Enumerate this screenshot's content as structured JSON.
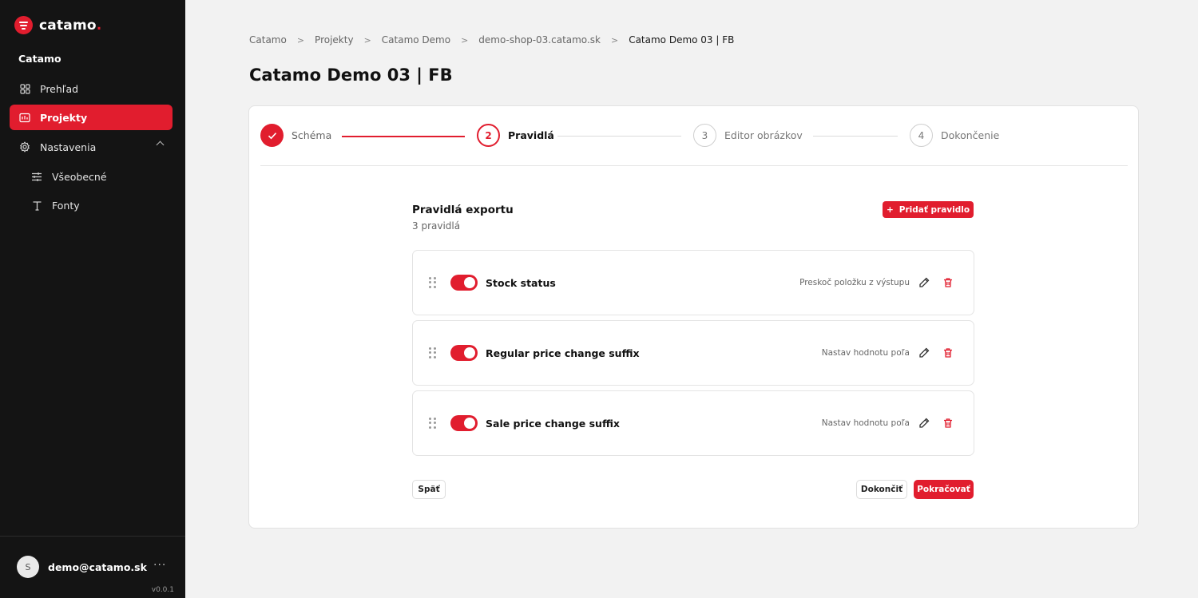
{
  "brand": {
    "name": "catamo",
    "dot": ".",
    "accent": "#e11d2e"
  },
  "sidebar": {
    "org": "Catamo",
    "items": [
      {
        "label": "Prehľad",
        "icon": "dashboard-icon"
      },
      {
        "label": "Projekty",
        "icon": "projects-icon",
        "active": true
      },
      {
        "label": "Nastavenia",
        "icon": "gear-icon",
        "expanded": true
      },
      {
        "label": "Všeobecné",
        "icon": "sliders-icon",
        "sub": true
      },
      {
        "label": "Fonty",
        "icon": "type-icon",
        "sub": true
      }
    ],
    "user": {
      "initial": "S",
      "email": "demo@catamo.sk",
      "more": "···"
    },
    "version": "v0.0.1"
  },
  "breadcrumb": [
    "Catamo",
    "Projekty",
    "Catamo Demo",
    "demo-shop-03.catamo.sk",
    "Catamo Demo 03 | FB"
  ],
  "page": {
    "title": "Catamo Demo 03 | FB"
  },
  "stepper": {
    "steps": [
      {
        "number": "",
        "label": "Schéma",
        "state": "done"
      },
      {
        "number": "2",
        "label": "Pravidlá",
        "state": "current"
      },
      {
        "number": "3",
        "label": "Editor obrázkov",
        "state": "todo"
      },
      {
        "number": "4",
        "label": "Dokončenie",
        "state": "todo"
      }
    ]
  },
  "rules_section": {
    "title": "Pravidlá exportu",
    "count": "3 pravidlá",
    "add_label": "Pridať pravidlo",
    "add_symbol": "+",
    "rules": [
      {
        "name": "Stock status",
        "action": "Preskoč položku z výstupu",
        "enabled": true
      },
      {
        "name": "Regular price change suffix",
        "action": "Nastav hodnotu poľa",
        "enabled": true
      },
      {
        "name": "Sale price change suffix",
        "action": "Nastav hodnotu poľa",
        "enabled": true
      }
    ]
  },
  "footer": {
    "back": "Späť",
    "finish": "Dokončiť",
    "continue": "Pokračovať"
  }
}
